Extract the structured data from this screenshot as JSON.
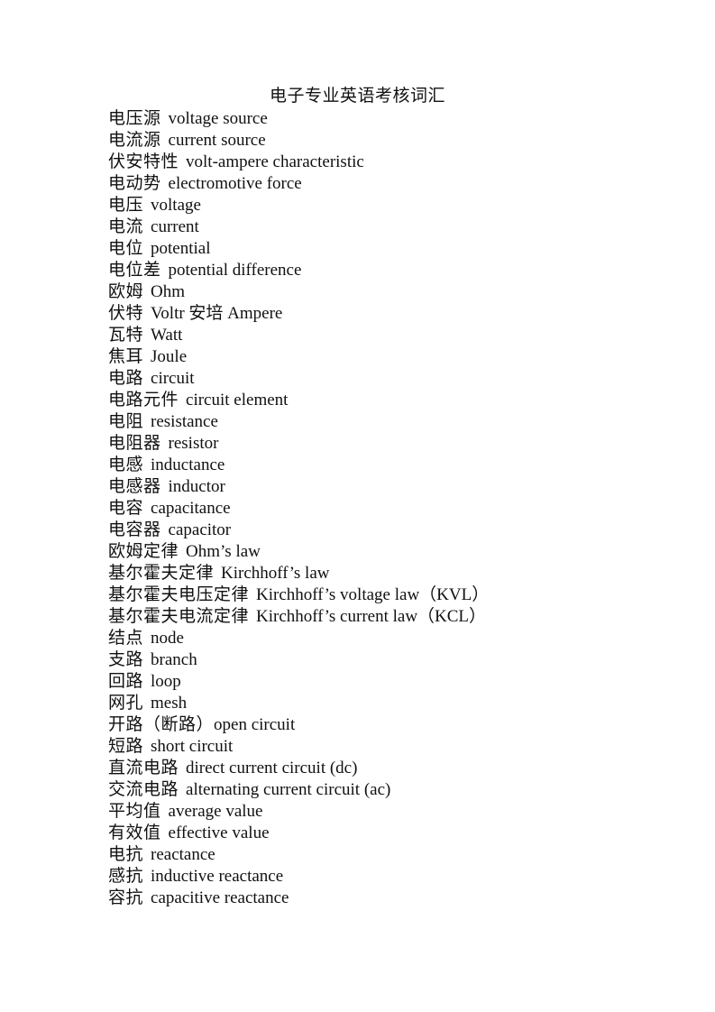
{
  "document": {
    "title": "电子专业英语考核词汇",
    "entries": [
      {
        "zh": "电压源",
        "en": "voltage source"
      },
      {
        "zh": "电流源",
        "en": "current source"
      },
      {
        "zh": "伏安特性",
        "en": "volt-ampere characteristic"
      },
      {
        "zh": "电动势",
        "en": "electromotive force"
      },
      {
        "zh": "电压",
        "en": "voltage"
      },
      {
        "zh": "电流",
        "en": "current"
      },
      {
        "zh": "电位",
        "en": "potential"
      },
      {
        "zh": "电位差",
        "en": "potential difference"
      },
      {
        "zh": "欧姆",
        "en": "Ohm"
      },
      {
        "zh": "伏特",
        "en": "Voltr 安培  Ampere"
      },
      {
        "zh": "瓦特",
        "en": "Watt"
      },
      {
        "zh": "焦耳",
        "en": "Joule"
      },
      {
        "zh": "电路",
        "en": "circuit"
      },
      {
        "zh": "电路元件",
        "en": "circuit element"
      },
      {
        "zh": "电阻",
        "en": "resistance"
      },
      {
        "zh": "电阻器",
        "en": "resistor"
      },
      {
        "zh": "电感",
        "en": "inductance"
      },
      {
        "zh": "电感器",
        "en": "inductor"
      },
      {
        "zh": "电容",
        "en": "capacitance"
      },
      {
        "zh": "电容器",
        "en": "capacitor"
      },
      {
        "zh": "欧姆定律",
        "en": "Ohm’s law"
      },
      {
        "zh": "基尔霍夫定律",
        "en": "Kirchhoff’s law"
      },
      {
        "zh": "基尔霍夫电压定律",
        "en": "Kirchhoff’s voltage law（KVL）"
      },
      {
        "zh": "基尔霍夫电流定律",
        "en": "Kirchhoff’s current law（KCL）"
      },
      {
        "zh": "结点",
        "en": "node"
      },
      {
        "zh": "支路",
        "en": "branch"
      },
      {
        "zh": "回路",
        "en": "loop"
      },
      {
        "zh": "网孔",
        "en": "mesh"
      },
      {
        "zh": "开路（断路）",
        "en": "open circuit"
      },
      {
        "zh": "短路",
        "en": "short circuit"
      },
      {
        "zh": "直流电路",
        "en": "direct current circuit (dc)"
      },
      {
        "zh": "交流电路",
        "en": "alternating current circuit (ac)"
      },
      {
        "zh": "平均值",
        "en": "average value"
      },
      {
        "zh": "有效值",
        "en": "effective value"
      },
      {
        "zh": "电抗",
        "en": "reactance"
      },
      {
        "zh": "感抗",
        "en": "inductive reactance"
      },
      {
        "zh": "容抗",
        "en": "capacitive reactance"
      }
    ]
  }
}
